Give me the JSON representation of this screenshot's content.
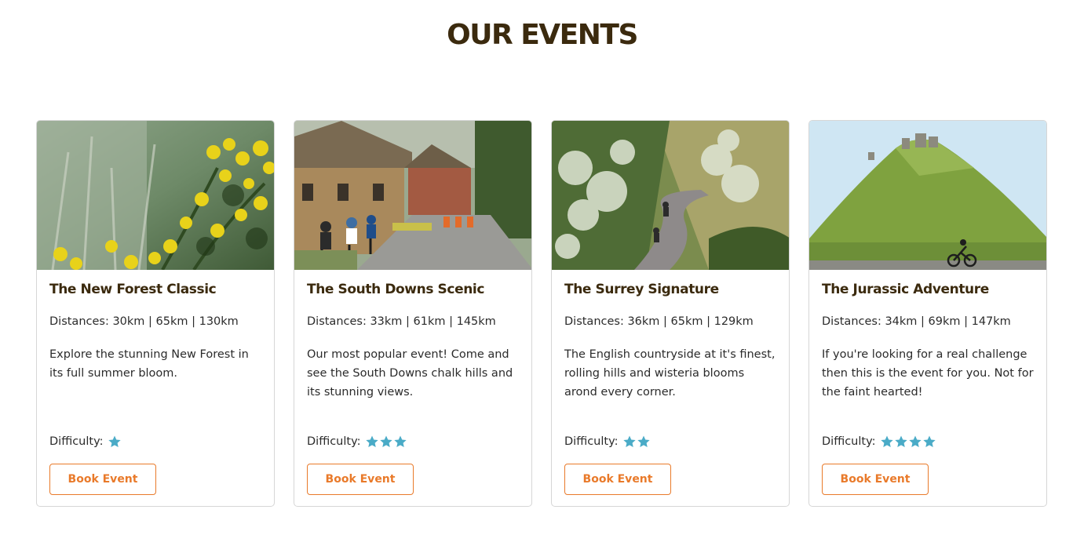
{
  "page": {
    "title": "OUR EVENTS"
  },
  "colors": {
    "title": "#3b2a0e",
    "accent": "#e97a2a",
    "star": "#4aabc7",
    "border": "#d6d6d6"
  },
  "events": [
    {
      "title": "The New Forest Classic",
      "distances": "Distances: 30km | 65km | 130km",
      "description": "Explore the stunning New Forest in its full summer bloom.",
      "difficulty_label": "Difficulty:",
      "difficulty": 1,
      "button_label": "Book Event",
      "image_icon": "gorse-flowers-photo"
    },
    {
      "title": "The South Downs Scenic",
      "distances": "Distances: 33km | 61km | 145km",
      "description": "Our most popular event! Come and see the South Downs chalk hills and its stunning views.",
      "difficulty_label": "Difficulty:",
      "difficulty": 3,
      "button_label": "Book Event",
      "image_icon": "village-cyclists-photo"
    },
    {
      "title": "The Surrey Signature",
      "distances": "Distances: 36km | 65km | 129km",
      "description": "The English countryside at it's finest, rolling hills and wisteria blooms arond every corner.",
      "difficulty_label": "Difficulty:",
      "difficulty": 2,
      "button_label": "Book Event",
      "image_icon": "country-lane-photo"
    },
    {
      "title": "The Jurassic Adventure",
      "distances": "Distances: 34km | 69km | 147km",
      "description": "If you're looking for a real challenge then this is the event for you. Not for the faint hearted!",
      "difficulty_label": "Difficulty:",
      "difficulty": 4,
      "button_label": "Book Event",
      "image_icon": "castle-hill-photo"
    }
  ]
}
